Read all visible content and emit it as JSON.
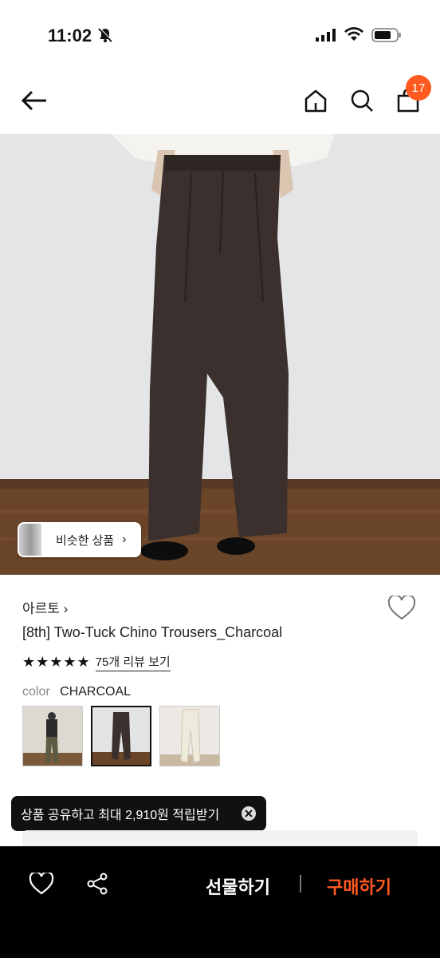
{
  "status_bar": {
    "time": "11:02"
  },
  "nav": {
    "cart_count": "17"
  },
  "hero": {
    "similar_label": "비슷한 상품"
  },
  "product": {
    "brand": "아르토",
    "title": "[8th] Two-Tuck Chino Trousers_Charcoal",
    "rating": {
      "stars": "★★★★★",
      "review_link": "75개 리뷰 보기"
    },
    "color_label": "color",
    "color_value": "CHARCOAL",
    "swatches": [
      "olive",
      "charcoal",
      "ivory"
    ]
  },
  "toast": {
    "message": "상품 공유하고 최대 2,910원 적립받기"
  },
  "bottom_bar": {
    "gift_label": "선물하기",
    "buy_label": "구매하기"
  },
  "colors": {
    "accent": "#ff5a1f",
    "bar_bg": "#000000"
  }
}
